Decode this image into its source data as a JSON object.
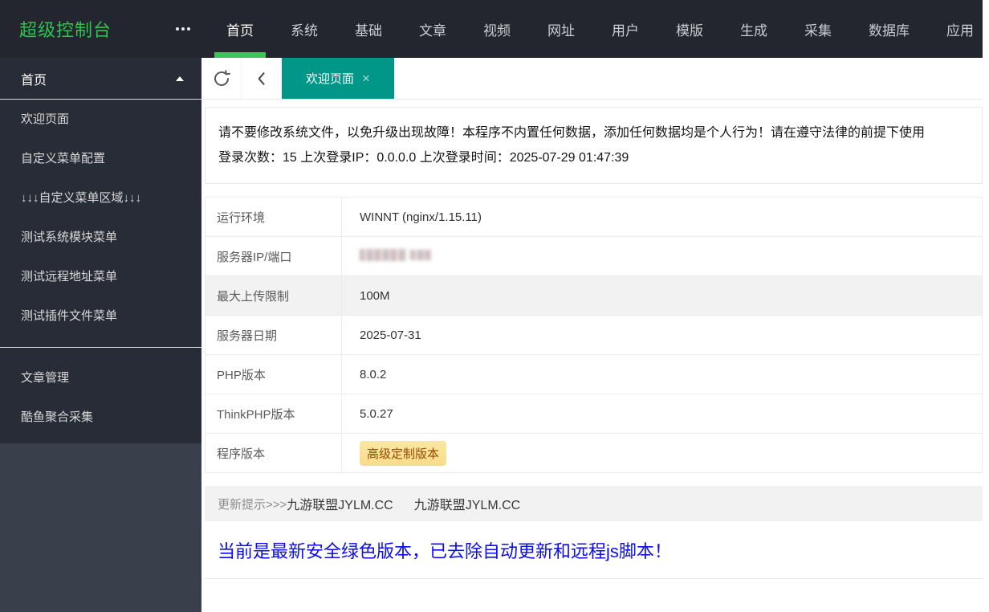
{
  "brand": {
    "title": "超级控制台"
  },
  "topnav": {
    "active_item": "首页",
    "items": [
      "首页",
      "系统",
      "基础",
      "文章",
      "视频",
      "网址",
      "用户",
      "模版",
      "生成",
      "采集",
      "数据库",
      "应用"
    ]
  },
  "sidebar": {
    "group_title": "首页",
    "items": [
      "欢迎页面",
      "自定义菜单配置",
      "↓↓↓自定义菜单区域↓↓↓",
      "测试系统模块菜单",
      "测试远程地址菜单",
      "测试插件文件菜单"
    ],
    "extra_items": [
      "文章管理",
      "酷鱼聚合采集"
    ]
  },
  "tabbar": {
    "active_tab": "欢迎页面",
    "close_label": "×"
  },
  "notice": {
    "line1": "请不要修改系统文件，以免升级出现故障！本程序不内置任何数据，添加任何数据均是个人行为！请在遵守法律的前提下使用",
    "line2": "登录次数：15 上次登录IP：0.0.0.0 上次登录时间：2025-07-29 01:47:39"
  },
  "info_table": {
    "rows": [
      {
        "label": "运行环境",
        "value": "WINNT (nginx/1.15.11)"
      },
      {
        "label": "服务器IP/端口",
        "value": "",
        "redacted": true
      },
      {
        "label": "最大上传限制",
        "value": "100M",
        "striped": true
      },
      {
        "label": "服务器日期",
        "value": "2025-07-31"
      },
      {
        "label": "PHP版本",
        "value": "8.0.2"
      },
      {
        "label": "ThinkPHP版本",
        "value": "5.0.27"
      },
      {
        "label": "程序版本",
        "value": "高级定制版本",
        "badge": true
      }
    ]
  },
  "update_bar": {
    "prefix": "更新提示>>>",
    "link1": "九游联盟JYLM.CC",
    "link2": "九游联盟JYLM.CC"
  },
  "status_line": "当前是最新安全绿色版本，已去除自动更新和远程js脚本！",
  "colors": {
    "topbar_bg": "#23262e",
    "sidebar_nav_bg": "#282c37",
    "sidebar_bg": "#3a3f4c",
    "brand_green": "#2ec24e",
    "nav_active_underline": "#3fc45a",
    "active_tab_teal": "#009688",
    "badge_bg": "#f8e093",
    "badge_text": "#964b00",
    "status_blue": "#0b0cf6",
    "stripe_gray": "#f2f2f2"
  }
}
